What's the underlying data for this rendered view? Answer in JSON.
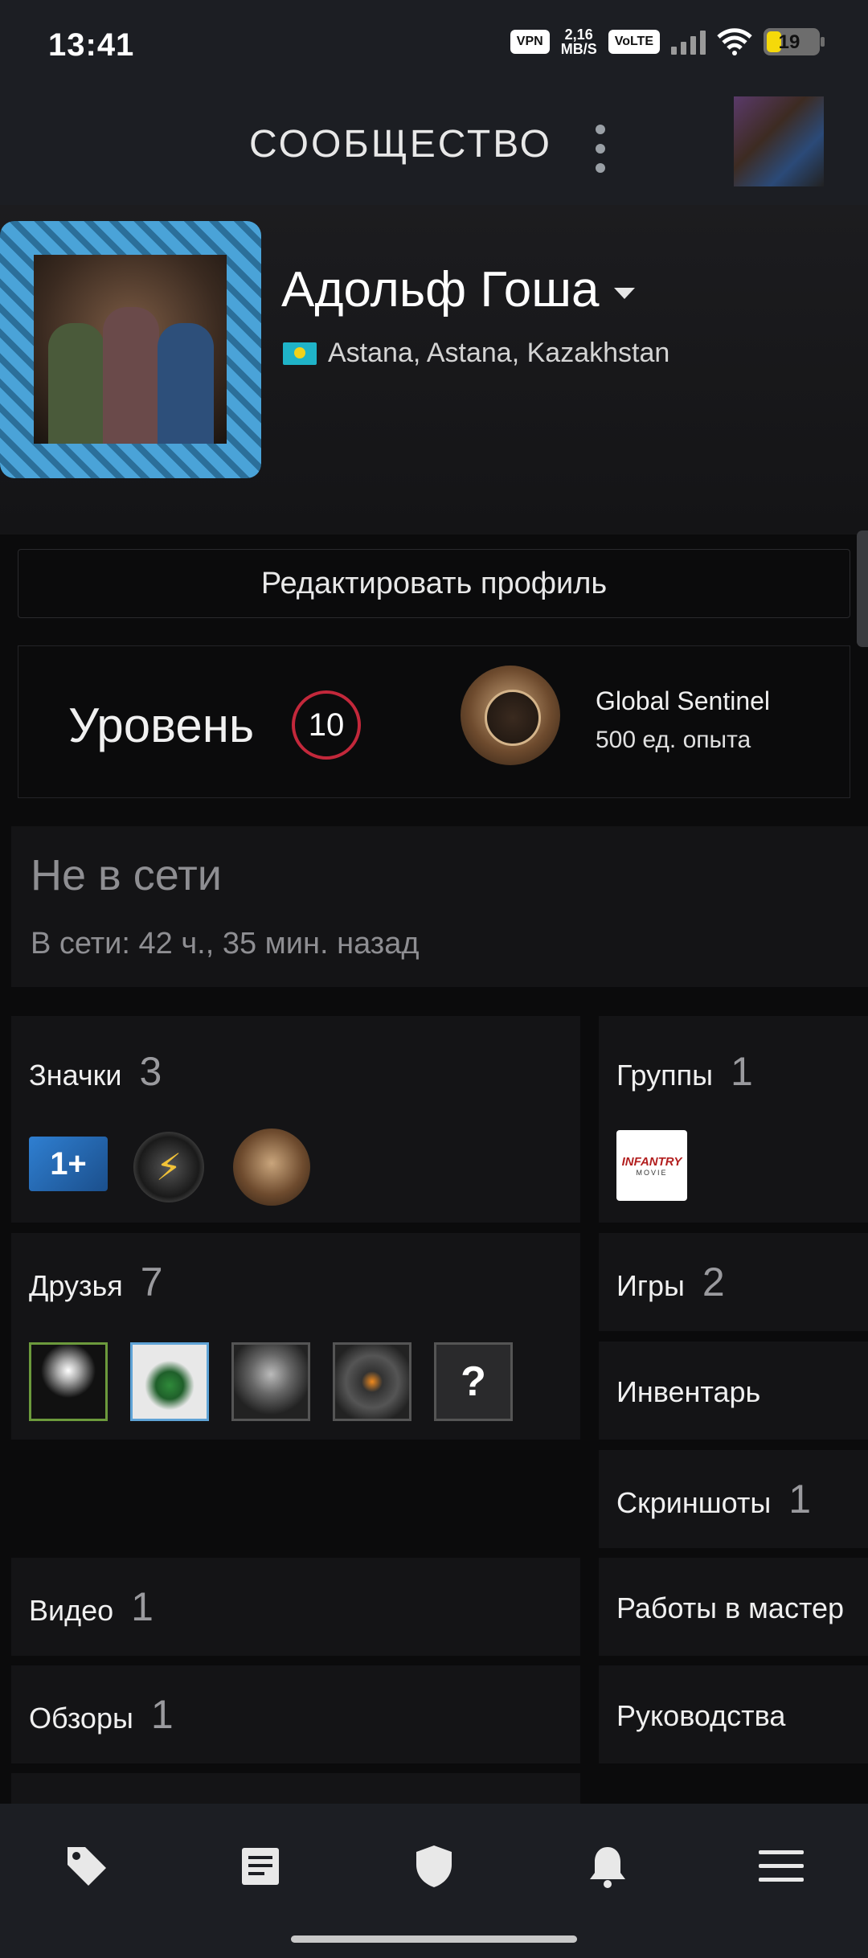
{
  "status_bar": {
    "time": "13:41",
    "vpn": "VPN",
    "speed_value": "2,16",
    "speed_unit": "MB/S",
    "volte": "VoLTE",
    "battery": "19"
  },
  "header": {
    "title": "СООБЩЕСТВО"
  },
  "profile": {
    "name": "Адольф Гоша",
    "location": "Astana, Astana, Kazakhstan"
  },
  "edit_button": "Редактировать профиль",
  "level": {
    "label": "Уровень",
    "value": "10",
    "badge_name": "Global Sentinel",
    "badge_xp": "500 ед. опыта"
  },
  "status": {
    "state": "Не в сети",
    "last_online": "В сети: 42 ч., 35 мин. назад"
  },
  "tiles": {
    "badges": {
      "label": "Значки",
      "count": "3"
    },
    "groups": {
      "label": "Группы",
      "count": "1",
      "group_logo_text": "INFANTRY",
      "group_logo_sub": "MOVIE"
    },
    "friends": {
      "label": "Друзья",
      "count": "7"
    },
    "games": {
      "label": "Игры",
      "count": "2"
    },
    "inventory": {
      "label": "Инвентарь"
    },
    "screenshots": {
      "label": "Скриншоты",
      "count": "1"
    },
    "videos": {
      "label": "Видео",
      "count": "1"
    },
    "workshop": {
      "label": "Работы в мастер"
    },
    "reviews": {
      "label": "Обзоры",
      "count": "1"
    },
    "guides": {
      "label": "Руководства"
    }
  },
  "badge_icons": [
    "one-plus-badge-icon",
    "lightning-badge-icon",
    "global-sentinel-badge-icon"
  ],
  "friend_icons": [
    "friend-avatar-1",
    "friend-avatar-2",
    "friend-avatar-3",
    "friend-avatar-4",
    "friend-avatar-unknown"
  ],
  "nav": [
    "store-tag-icon",
    "news-icon",
    "shield-icon",
    "bell-icon",
    "menu-icon"
  ],
  "colors": {
    "background": "#0b0b0c",
    "panel": "#141416",
    "header": "#1c1e23",
    "level_ring": "#c3283b"
  }
}
